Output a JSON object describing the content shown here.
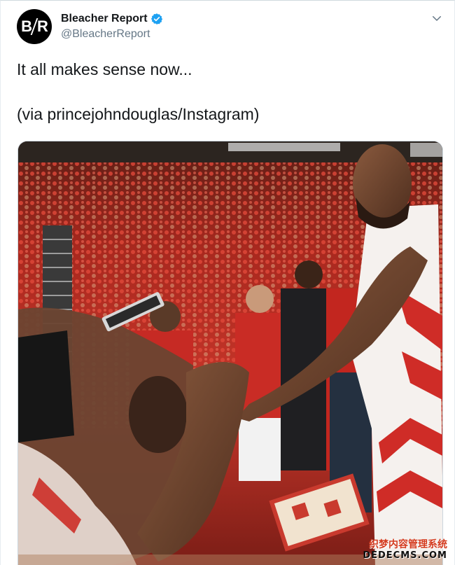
{
  "tweet": {
    "author": {
      "display_name": "Bleacher Report",
      "handle": "@BleacherReport",
      "avatar_text_left": "B",
      "avatar_text_right": "R",
      "verified": true
    },
    "text_line_1": "It all makes sense now...",
    "text_line_2": "(via princejohndouglas/Instagram)",
    "media": {
      "type": "video-frame",
      "description_icon": "basketball-arena-scene"
    }
  },
  "watermark": {
    "line_1": "织梦内容管理系统",
    "line_2": "DEDECMS.COM"
  },
  "colors": {
    "text_primary": "#14171a",
    "text_secondary": "#657786",
    "verified_blue": "#1da1f2",
    "crowd_red": "#c8241c"
  }
}
